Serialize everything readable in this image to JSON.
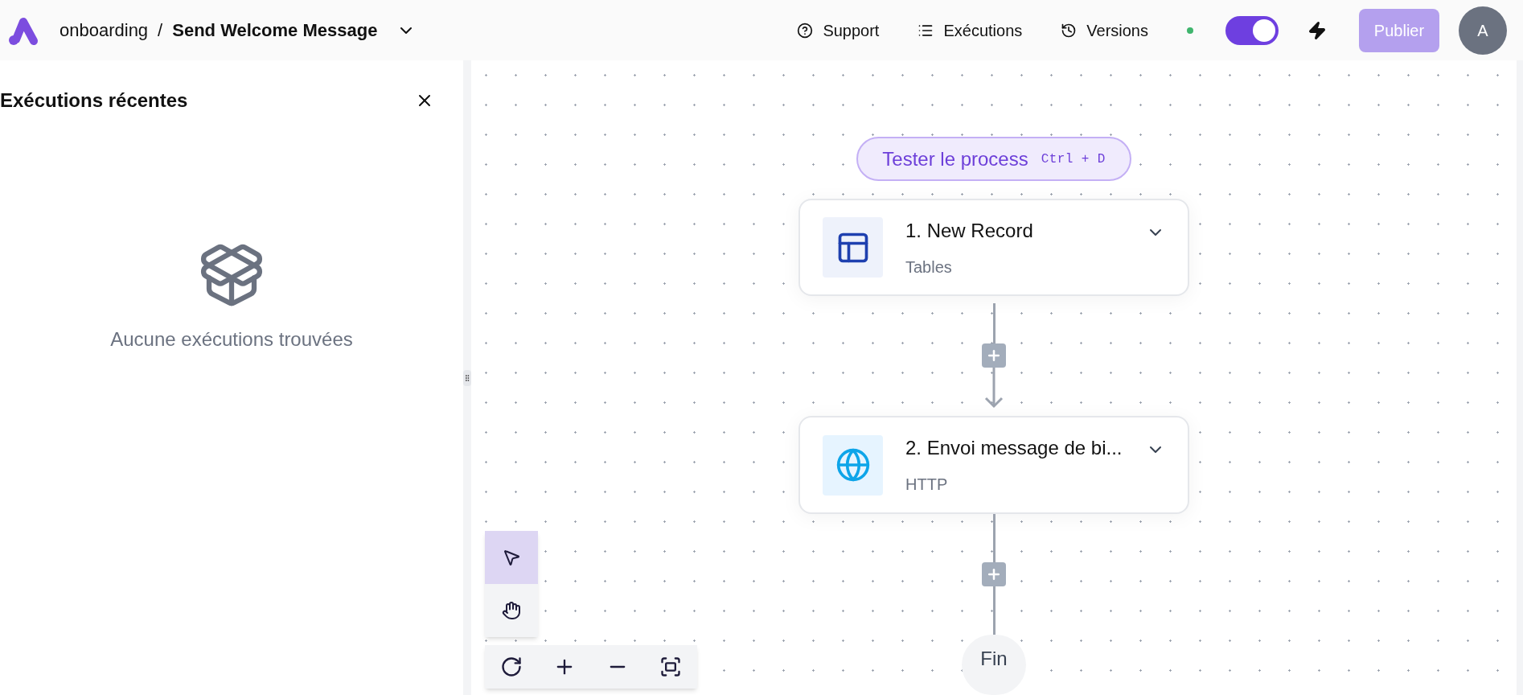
{
  "header": {
    "project": "onboarding",
    "separator": "/",
    "flow_name": "Send Welcome Message",
    "nav": [
      {
        "kind": "help",
        "label": "Support"
      },
      {
        "kind": "list",
        "label": "Exécutions"
      },
      {
        "kind": "history",
        "label": "Versions"
      }
    ],
    "live": true,
    "toggle": {
      "on": true
    },
    "publish": {
      "label": "Publier",
      "disabled": true
    },
    "avatar": "A"
  },
  "panel": {
    "title": "Exécutions récentes",
    "empty_text": "Aucune exécutions trouvées"
  },
  "canvas": {
    "test_button": {
      "label": "Tester le process",
      "shortcut": "Ctrl + D"
    },
    "steps": [
      {
        "kind": "table",
        "title": "1. New Record",
        "app": "Tables"
      },
      {
        "kind": "http",
        "title": "2. Envoi message de bi...",
        "app": "HTTP"
      }
    ],
    "end_label": "Fin",
    "tools": [
      {
        "kind": "select",
        "selected": true
      },
      {
        "kind": "pan",
        "selected": false
      }
    ]
  }
}
